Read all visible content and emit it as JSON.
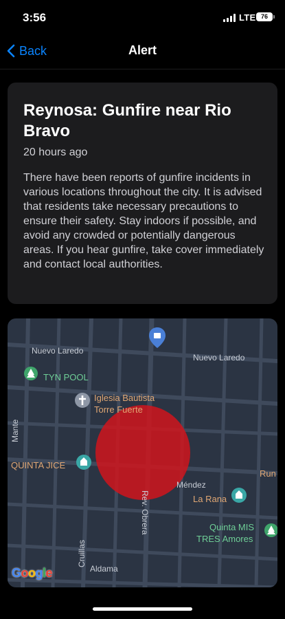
{
  "status_bar": {
    "time": "3:56",
    "network": "LTE",
    "battery": "76"
  },
  "nav": {
    "back_label": "Back",
    "title": "Alert"
  },
  "alert": {
    "title": "Reynosa: Gunfire near Rio Bravo",
    "time_ago": "20 hours ago",
    "body": "There have been reports of gunfire incidents in various locations throughout the city. It is advised that residents take necessary precautions to ensure their safety. Stay indoors if possible, and avoid any crowded or potentially dangerous areas. If you hear gunfire, take cover immediately and contact local authorities."
  },
  "map": {
    "streets": {
      "nuevo_laredo_1": "Nuevo Laredo",
      "nuevo_laredo_2": "Nuevo Laredo",
      "mante": "Mante",
      "mendez": "Méndez",
      "rev_obrera": "Rev. Obrera",
      "cruillas": "Cruillas",
      "aldama": "Aldama"
    },
    "places": {
      "tyn_pool": "TYN POOL",
      "iglesia_1": "Iglesia Bautista",
      "iglesia_2": "Torre Fuerte",
      "quinta_jice": "QUINTA JICE",
      "la_rana": "La Rana",
      "quinta_mis_1": "Quinta MIS",
      "quinta_mis_2": "TRES Amores",
      "run": "Run"
    },
    "logo": "Google",
    "colors": {
      "incident_zone": "#d0151c",
      "water_blue": "#4a7fd6"
    }
  }
}
